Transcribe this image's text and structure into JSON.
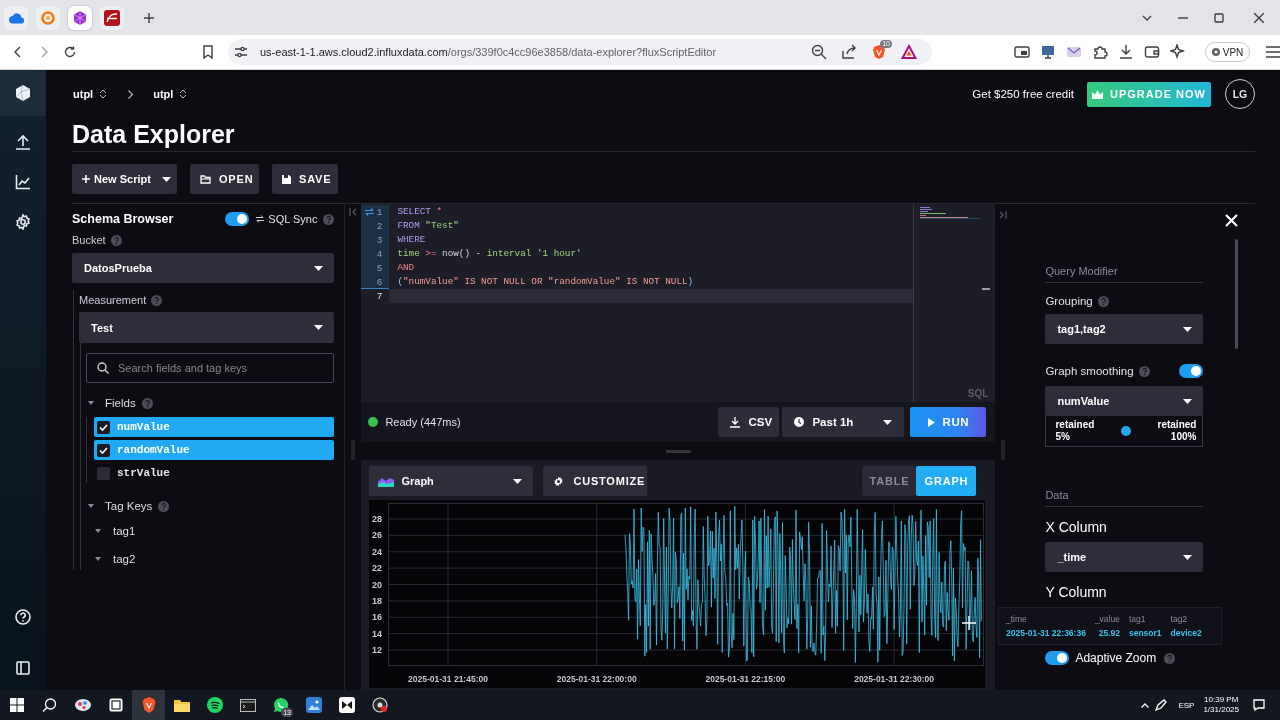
{
  "browser": {
    "tabs": [
      {
        "kind": "cloud",
        "selected": false
      },
      {
        "kind": "ring",
        "selected": false
      },
      {
        "kind": "hexagon",
        "selected": true
      },
      {
        "kind": "curve",
        "selected": false
      }
    ],
    "address": {
      "host": "us-east-1-1.aws.cloud2.influxdata.com",
      "path": "/orgs/339f0c4cc96e3858/data-explorer?fluxScriptEditor"
    },
    "shield_count": "10",
    "vpn": "VPN"
  },
  "header": {
    "breadcrumb": [
      "utpl",
      "utpl"
    ],
    "credit": "Get $250 free credit",
    "upgrade": "UPGRADE NOW",
    "avatar": "LG"
  },
  "title": "Data Explorer",
  "toolbar": [
    {
      "kind": "new",
      "label": "New Script"
    },
    {
      "kind": "open",
      "label": "OPEN"
    },
    {
      "kind": "save",
      "label": "SAVE"
    }
  ],
  "schema_browser": {
    "title": "Schema Browser",
    "sql_sync": {
      "label": "SQL Sync",
      "on": true
    },
    "bucket": {
      "label": "Bucket",
      "value": "DatosPrueba"
    },
    "measurement": {
      "label": "Measurement",
      "value": "Test"
    },
    "search": {
      "placeholder": "Search fields and tag keys"
    },
    "fields": {
      "label": "Fields",
      "expanded": true,
      "items": [
        {
          "name": "numValue",
          "checked": true
        },
        {
          "name": "randomValue",
          "checked": true
        },
        {
          "name": "strValue",
          "checked": false
        }
      ]
    },
    "tag_keys": {
      "label": "Tag Keys",
      "expanded": true,
      "items": [
        {
          "name": "tag1"
        },
        {
          "name": "tag2"
        }
      ]
    }
  },
  "editor": {
    "lines": [
      {
        "number": "1",
        "synced": true,
        "current": false,
        "tokens": [
          {
            "text": "SELECT ",
            "kind": "keyword"
          },
          {
            "text": "*",
            "kind": "operator"
          }
        ]
      },
      {
        "number": "2",
        "synced": true,
        "current": false,
        "tokens": [
          {
            "text": "FROM ",
            "kind": "keyword"
          },
          {
            "text": "\"Test\"",
            "kind": "string"
          }
        ]
      },
      {
        "number": "3",
        "synced": true,
        "current": false,
        "tokens": [
          {
            "text": "WHERE",
            "kind": "keyword"
          }
        ]
      },
      {
        "number": "4",
        "synced": true,
        "current": false,
        "tokens": [
          {
            "text": "time",
            "kind": "identifier"
          },
          {
            "text": " >=",
            "kind": "operator"
          },
          {
            "text": " now() - ",
            "kind": "plain"
          },
          {
            "text": "interval '1 hour'",
            "kind": "string"
          }
        ]
      },
      {
        "number": "5",
        "synced": true,
        "current": false,
        "tokens": [
          {
            "text": "AND",
            "kind": "operator"
          }
        ]
      },
      {
        "number": "6",
        "synced": true,
        "current": false,
        "tokens": [
          {
            "text": "(",
            "kind": "paren"
          },
          {
            "text": "\"numValue\" IS NOT NULL OR \"randomValue\" IS NOT NULL",
            "kind": "logic"
          },
          {
            "text": ")",
            "kind": "paren"
          }
        ]
      },
      {
        "number": "7",
        "synced": false,
        "current": true
      }
    ],
    "language": "SQL"
  },
  "run_bar": {
    "status": {
      "kind": "ready",
      "text": "Ready (447ms)"
    },
    "csv": "CSV",
    "time_range": "Past 1h",
    "run": "RUN"
  },
  "results": {
    "view": "Graph",
    "customize": "CUSTOMIZE",
    "tabs": [
      {
        "label": "TABLE",
        "selected": false
      },
      {
        "label": "GRAPH",
        "selected": true
      }
    ],
    "graph": {
      "y_ticks": [
        "28",
        "26",
        "24",
        "22",
        "20",
        "18",
        "16",
        "14",
        "12"
      ],
      "x_ticks": [
        "2025-01-31 21:45:00",
        "2025-01-31 22:00:00",
        "2025-01-31 22:15:00",
        "2025-01-31 22:30:00"
      ]
    },
    "tooltip": [
      {
        "header": "_time",
        "value": "2025-01-31 22:36:36"
      },
      {
        "header": "_value",
        "value": "25.92"
      },
      {
        "header": "tag1",
        "value": "sensor1"
      },
      {
        "header": "tag2",
        "value": "device2"
      }
    ]
  },
  "options": {
    "query_modifier": {
      "title": "Query Modifier",
      "grouping": {
        "label": "Grouping",
        "value": "tag1,tag2"
      },
      "smoothing": {
        "label": "Graph smoothing",
        "on": true,
        "column": "numValue",
        "min_label": "retained",
        "min_value": "5%",
        "max_label": "retained",
        "max_value": "100%",
        "level": 0.5
      }
    },
    "data": {
      "title": "Data",
      "x_column": {
        "label": "X Column",
        "value": "_time"
      },
      "y_column": {
        "label": "Y Column"
      }
    },
    "adaptive_zoom": {
      "label": "Adaptive Zoom",
      "on": true
    }
  },
  "taskbar": {
    "apps": [
      {
        "kind": "start",
        "selected": false
      },
      {
        "kind": "search",
        "selected": false
      },
      {
        "kind": "paint",
        "selected": false
      },
      {
        "kind": "notes",
        "selected": false
      },
      {
        "kind": "browser",
        "selected": true
      },
      {
        "kind": "files",
        "selected": false
      },
      {
        "kind": "music",
        "selected": false
      },
      {
        "kind": "terminal",
        "selected": false
      },
      {
        "kind": "chat",
        "selected": false,
        "badge": "13"
      },
      {
        "kind": "photos",
        "selected": false
      },
      {
        "kind": "video",
        "selected": false
      },
      {
        "kind": "recorder",
        "selected": false
      }
    ],
    "language": "ESP",
    "time": "10:39 PM",
    "date": "1/31/2025"
  }
}
